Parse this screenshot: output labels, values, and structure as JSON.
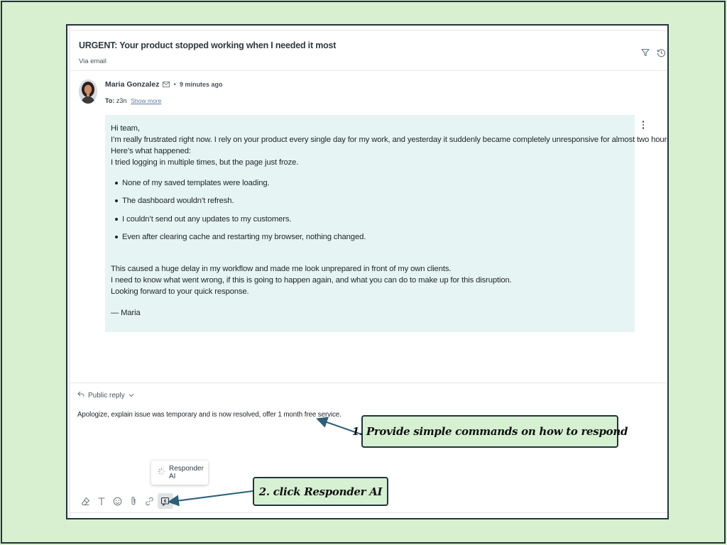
{
  "ticket": {
    "subject": "URGENT: Your product stopped working when I needed it most",
    "channel": "Via email",
    "header_icons": [
      "filter-icon",
      "history-icon"
    ]
  },
  "message": {
    "sender": "Maria Gonzalez",
    "separator": "•",
    "time": "9 minutes ago",
    "to_label": "To:",
    "to_value": "z3n",
    "show_more": "Show more",
    "lines_intro": [
      "Hi team,",
      "I’m really frustrated right now. I rely on your product every single day for my work, and yesterday it suddenly became completely unresponsive for almost two hours.",
      "Here’s what happened:",
      "I tried logging in multiple times, but the page just froze."
    ],
    "bullets": [
      "None of my saved templates were loading.",
      "The dashboard wouldn’t refresh.",
      "I couldn’t send out any updates to my customers.",
      "Even after clearing cache and restarting my browser, nothing changed."
    ],
    "lines_outro": [
      "This caused a huge delay in my workflow and made me look unprepared in front of my own clients.",
      "I need to know what went wrong, if this is going to happen again, and what you can do to make up for this disruption.",
      "Looking forward to your quick response."
    ],
    "signature": "— Maria"
  },
  "reply": {
    "type_label": "Public reply",
    "draft_text": "Apologize, explain issue was temporary and is now resolved, offer 1 month free service.",
    "responder_label": "Responder AI",
    "toolbar_icons": [
      "eraser-icon",
      "text-format-icon",
      "emoji-icon",
      "attachment-icon",
      "link-icon",
      "responder-ai-icon"
    ]
  },
  "annotations": {
    "step1": "1. Provide simple commands on how to respond",
    "step2": "2. click Responder AI"
  },
  "colors": {
    "background": "#d8efd0",
    "message_bubble": "#e6f5f3",
    "callout_fill": "#d6f0d2",
    "arrow": "#2c5f78"
  }
}
